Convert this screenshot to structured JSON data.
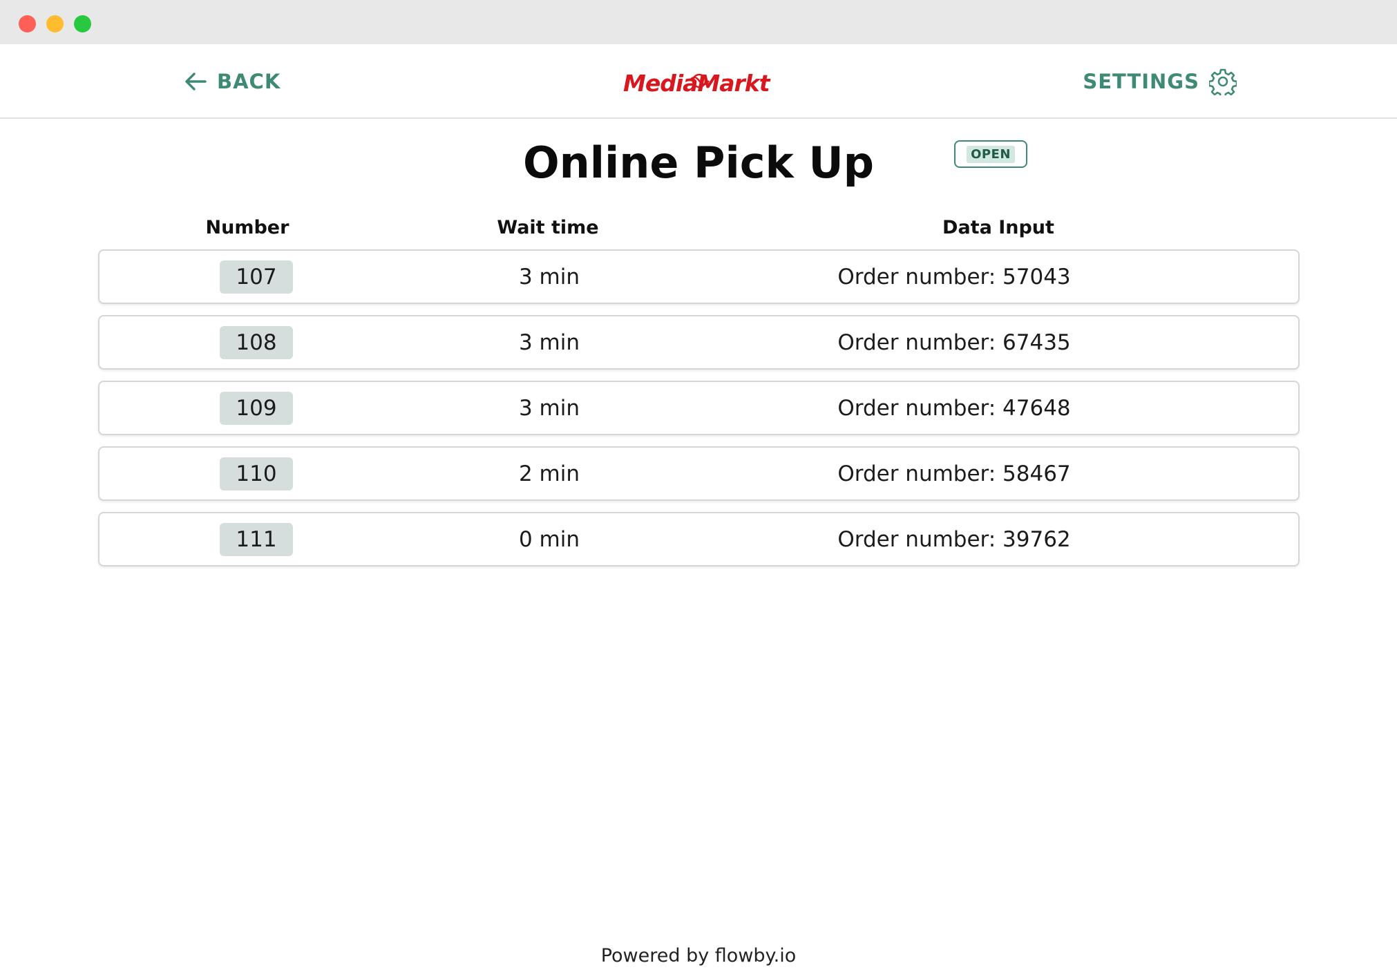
{
  "header": {
    "back_label": "BACK",
    "logo_text": "MediaMarkt",
    "settings_label": "SETTINGS"
  },
  "page": {
    "title": "Online Pick Up",
    "status": "OPEN"
  },
  "table": {
    "columns": [
      "Number",
      "Wait time",
      "Data Input"
    ],
    "rows": [
      {
        "number": "107",
        "wait": "3 min",
        "data": "Order number: 57043"
      },
      {
        "number": "108",
        "wait": "3 min",
        "data": "Order number: 67435"
      },
      {
        "number": "109",
        "wait": "3 min",
        "data": "Order number: 47648"
      },
      {
        "number": "110",
        "wait": "2 min",
        "data": "Order number: 58467"
      },
      {
        "number": "111",
        "wait": "0 min",
        "data": "Order number: 39762"
      }
    ]
  },
  "footer": {
    "text": "Powered by flowby.io"
  },
  "colors": {
    "accent": "#3f8a74",
    "brand_red": "#d7191f",
    "pill_bg": "#d6dedd"
  },
  "icons": {
    "back": "arrow-left-icon",
    "settings": "gear-icon"
  }
}
